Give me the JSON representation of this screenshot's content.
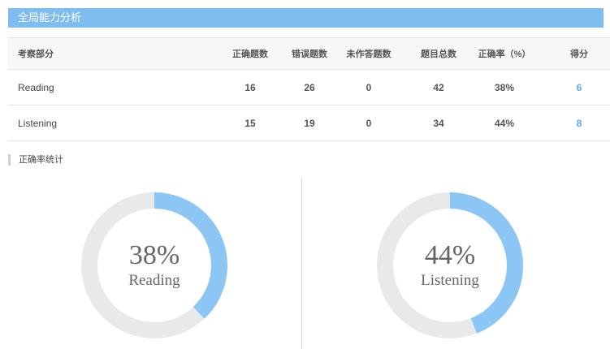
{
  "panel": {
    "title": "全局能力分析"
  },
  "table": {
    "headers": [
      "考察部分",
      "正确题数",
      "错误题数",
      "未作答题数",
      "题目总数",
      "正确率（%）",
      "得分"
    ],
    "rows": [
      [
        "Reading",
        "16",
        "26",
        "0",
        "42",
        "38%",
        "6"
      ],
      [
        "Listening",
        "15",
        "19",
        "0",
        "34",
        "44%",
        "8"
      ]
    ]
  },
  "stats": {
    "title": "正确率统计",
    "donuts": [
      {
        "percent_label": "38%",
        "name": "Reading",
        "value": 38
      },
      {
        "percent_label": "44%",
        "name": "Listening",
        "value": 44
      }
    ]
  },
  "colors": {
    "accent": "#7fbdf0",
    "ring_fill": "#8cc6f5",
    "ring_track": "#e8e9eb",
    "score": "#5aa9ec"
  }
}
